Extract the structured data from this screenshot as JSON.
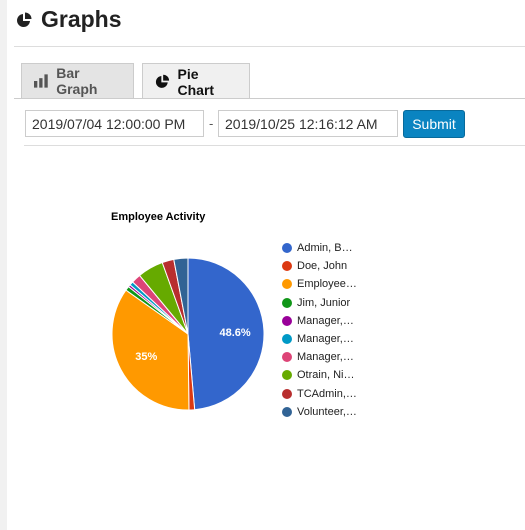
{
  "page": {
    "title": "Graphs",
    "icon": "pie-chart-icon"
  },
  "tabs": [
    {
      "label": "Bar Graph",
      "icon": "bar-chart-icon"
    },
    {
      "label": "Pie Chart",
      "icon": "pie-chart-icon",
      "active": true
    }
  ],
  "filter": {
    "start": "2019/07/04 12:00:00 PM",
    "separator": "-",
    "end": "2019/10/25 12:16:12 AM",
    "submit_label": "Submit"
  },
  "chart_data": {
    "type": "pie",
    "title": "Employee Activity",
    "legend": "right",
    "labels": [
      "Admin, B…",
      "Doe, John",
      "Employee…",
      "Jim, Junior",
      "Manager,…",
      "Manager,…",
      "Manager,…",
      "Otrain, Ni…",
      "TCAdmin,…",
      "Volunteer,…"
    ],
    "values": [
      48.6,
      1.2,
      35,
      0.9,
      0.5,
      0.8,
      2.0,
      5.5,
      2.5,
      3.0
    ],
    "slice_labels": [
      "48.6%",
      "",
      "35%",
      "",
      "",
      "",
      "",
      "",
      "",
      ""
    ],
    "colors": [
      "#3366cc",
      "#dc3912",
      "#ff9900",
      "#109618",
      "#990099",
      "#0099c6",
      "#dd4477",
      "#66aa00",
      "#b82e2e",
      "#316395"
    ]
  }
}
